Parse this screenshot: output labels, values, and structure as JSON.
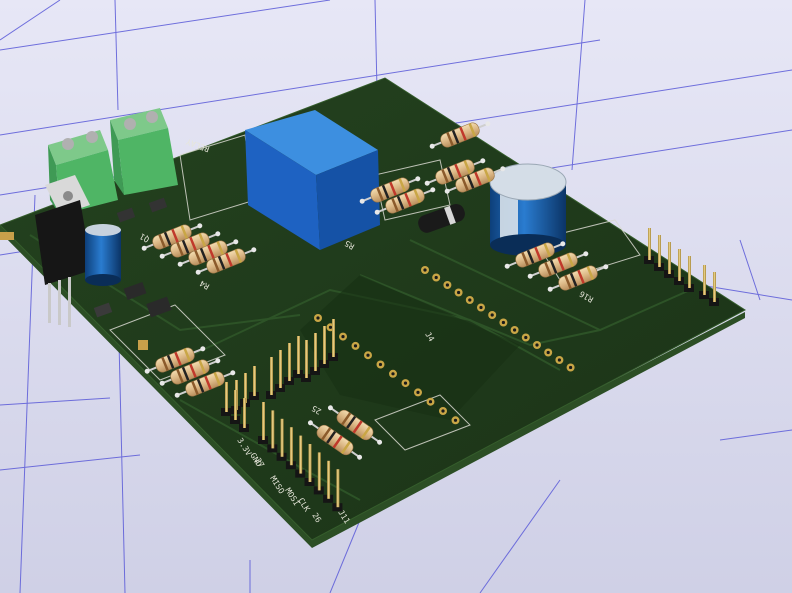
{
  "scene": {
    "background_top": "#e7e7f6",
    "background_bottom": "#cfd0e6",
    "grid_color": "#5a5ad8",
    "board_color": "#1f3a1c",
    "board_edge": "#2c4e25"
  },
  "silkscreen": {
    "j4": "J4",
    "r16": "R16",
    "j11": "J11",
    "pin26": "26",
    "pin25": "25",
    "pin27": "27",
    "pin3v3": "3.3V",
    "gnd": "GND",
    "miso": "MISO",
    "mosi": "MOSI",
    "clk": "CLK",
    "relay": "RELAY",
    "r5": "R5",
    "r4": "R4",
    "q1": "Q1"
  },
  "components": {
    "relay": "relay-cube",
    "terminal_blocks": "screw-terminal-2pin",
    "regulator": "to220-regulator",
    "capacitors": "electrolytic-capacitor",
    "resistors": "axial-resistor",
    "diode": "axial-diode",
    "headers": "pin-header"
  }
}
